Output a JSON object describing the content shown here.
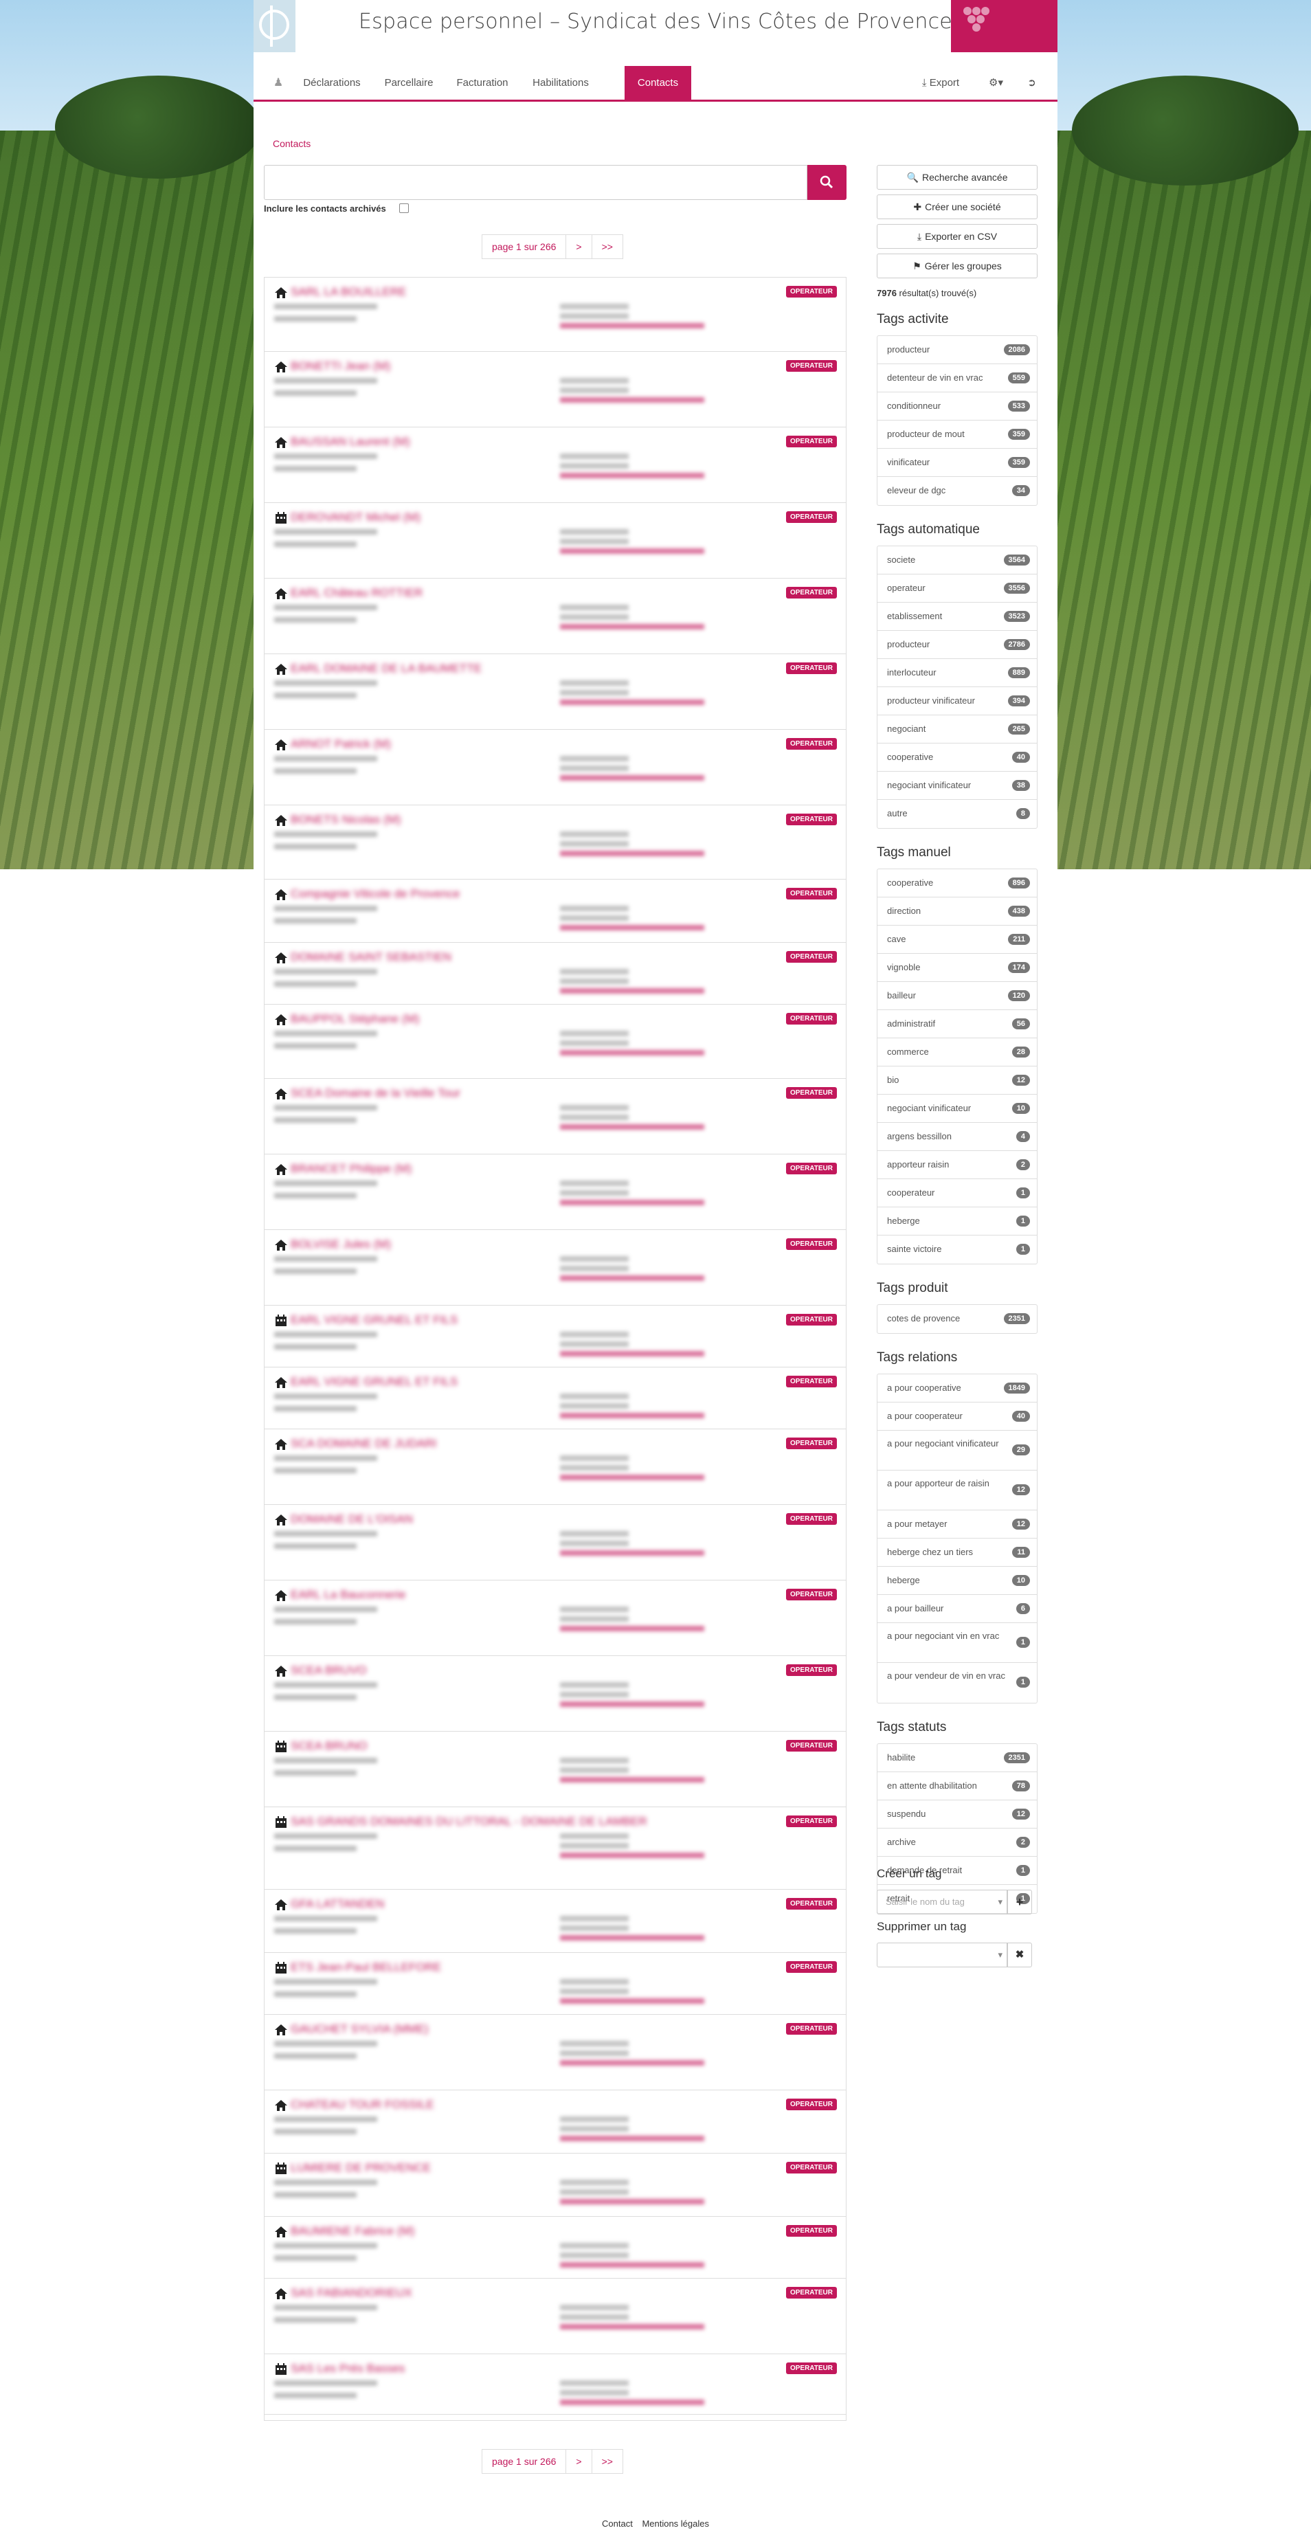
{
  "header": {
    "title": "Espace personnel – Syndicat des Vins Côtes de Provence"
  },
  "nav": {
    "items": [
      "Déclarations",
      "Parcellaire",
      "Facturation",
      "Habilitations",
      "Contacts"
    ],
    "export_label": "Export"
  },
  "breadcrumb": "Contacts",
  "search": {
    "placeholder": "",
    "archive_label": "Inclure les contacts archivés"
  },
  "pagination": {
    "label": "page 1 sur 266",
    "next": ">",
    "last": ">>"
  },
  "contacts": {
    "badge": "OPERATEUR",
    "rows": [
      {
        "icon": "home",
        "name": "SARL LA BOUILLERE"
      },
      {
        "icon": "home",
        "name": "BONETTI Jean (M)"
      },
      {
        "icon": "home",
        "name": "BAUSSAN Laurent (M)"
      },
      {
        "icon": "calendar",
        "name": "DEROVANDT Michel (M)"
      },
      {
        "icon": "home",
        "name": "EARL Château ROTTIER"
      },
      {
        "icon": "home",
        "name": "EARL DOMAINE DE LA BAUMETTE"
      },
      {
        "icon": "home",
        "name": "ARNOT Patrick (M)"
      },
      {
        "icon": "home",
        "name": "BONETS Nicolas (M)"
      },
      {
        "icon": "home",
        "name": "Compagnie Viticole de Provence"
      },
      {
        "icon": "home",
        "name": "DOMAINE SAINT SEBASTIEN"
      },
      {
        "icon": "home",
        "name": "BAUPPOL Stéphane (M)"
      },
      {
        "icon": "home",
        "name": "SCEA Domaine de la Vieille Tour"
      },
      {
        "icon": "home",
        "name": "BRANCET Philippe (M)"
      },
      {
        "icon": "home",
        "name": "BOLVISE Jules (M)"
      },
      {
        "icon": "calendar",
        "name": "EARL VIGNE GRUNEL ET FILS"
      },
      {
        "icon": "home",
        "name": "EARL VIGNE GRUNEL ET FILS"
      },
      {
        "icon": "home",
        "name": "SCA DOMAINE DE JUDARI"
      },
      {
        "icon": "home",
        "name": "DOMAINE DE L'OISAN"
      },
      {
        "icon": "home",
        "name": "EARL La Bauconnerie"
      },
      {
        "icon": "home",
        "name": "SCEA BRUVO"
      },
      {
        "icon": "calendar",
        "name": "SCEA BRUNO"
      },
      {
        "icon": "calendar",
        "name": "SAS GRANDS DOMAINES DU LITTORAL - DOMAINE DE LAMBER"
      },
      {
        "icon": "home",
        "name": "GFA LATTANDEN"
      },
      {
        "icon": "calendar",
        "name": "ETS Jean-Paul BELLEFORE"
      },
      {
        "icon": "home",
        "name": "GAUCHET SYLVIA (MME)"
      },
      {
        "icon": "home",
        "name": "CHATEAU TOUR FOSSILE"
      },
      {
        "icon": "calendar",
        "name": "LUMIERE DE PROVENCE"
      },
      {
        "icon": "home",
        "name": "BAUMIENE Fabrice (M)"
      },
      {
        "icon": "home",
        "name": "SAS FABIANDORIEUX"
      },
      {
        "icon": "calendar",
        "name": "SAS Les Prés Basses"
      }
    ]
  },
  "sidebar": {
    "buttons": [
      "Recherche avancée",
      "Créer une société",
      "Exporter en CSV",
      "Gérer les groupes"
    ],
    "result_count": "7976",
    "result_label": " résultat(s) trouvé(s)",
    "groups": [
      {
        "title": "Tags activite",
        "items": [
          {
            "label": "producteur",
            "count": "2086"
          },
          {
            "label": "detenteur de vin en vrac",
            "count": "559"
          },
          {
            "label": "conditionneur",
            "count": "533"
          },
          {
            "label": "producteur de mout",
            "count": "359"
          },
          {
            "label": "vinificateur",
            "count": "359"
          },
          {
            "label": "eleveur de dgc",
            "count": "34"
          }
        ]
      },
      {
        "title": "Tags automatique",
        "items": [
          {
            "label": "societe",
            "count": "3564"
          },
          {
            "label": "operateur",
            "count": "3556"
          },
          {
            "label": "etablissement",
            "count": "3523"
          },
          {
            "label": "producteur",
            "count": "2786"
          },
          {
            "label": "interlocuteur",
            "count": "889"
          },
          {
            "label": "producteur vinificateur",
            "count": "394"
          },
          {
            "label": "negociant",
            "count": "265"
          },
          {
            "label": "cooperative",
            "count": "40"
          },
          {
            "label": "negociant vinificateur",
            "count": "38"
          },
          {
            "label": "autre",
            "count": "8"
          }
        ]
      },
      {
        "title": "Tags manuel",
        "items": [
          {
            "label": "cooperative",
            "count": "896"
          },
          {
            "label": "direction",
            "count": "438"
          },
          {
            "label": "cave",
            "count": "211"
          },
          {
            "label": "vignoble",
            "count": "174"
          },
          {
            "label": "bailleur",
            "count": "120"
          },
          {
            "label": "administratif",
            "count": "56"
          },
          {
            "label": "commerce",
            "count": "28"
          },
          {
            "label": "bio",
            "count": "12"
          },
          {
            "label": "negociant vinificateur",
            "count": "10"
          },
          {
            "label": "argens bessillon",
            "count": "4"
          },
          {
            "label": "apporteur raisin",
            "count": "2"
          },
          {
            "label": "cooperateur",
            "count": "1"
          },
          {
            "label": "heberge",
            "count": "1"
          },
          {
            "label": "sainte victoire",
            "count": "1"
          }
        ]
      },
      {
        "title": "Tags produit",
        "items": [
          {
            "label": "cotes de provence",
            "count": "2351"
          }
        ]
      },
      {
        "title": "Tags relations",
        "items": [
          {
            "label": "a pour cooperative",
            "count": "1849"
          },
          {
            "label": "a pour cooperateur",
            "count": "40"
          },
          {
            "label": "a pour negociant vinificateur",
            "count": "29"
          },
          {
            "label": "a pour apporteur de raisin",
            "count": "12"
          },
          {
            "label": "a pour metayer",
            "count": "12"
          },
          {
            "label": "heberge chez un tiers",
            "count": "11"
          },
          {
            "label": "heberge",
            "count": "10"
          },
          {
            "label": "a pour bailleur",
            "count": "6"
          },
          {
            "label": "a pour negociant vin en vrac",
            "count": "1"
          },
          {
            "label": "a pour vendeur de vin en vrac",
            "count": "1"
          }
        ]
      },
      {
        "title": "Tags statuts",
        "items": [
          {
            "label": "habilite",
            "count": "2351"
          },
          {
            "label": "en attente dhabilitation",
            "count": "78"
          },
          {
            "label": "suspendu",
            "count": "12"
          },
          {
            "label": "archive",
            "count": "2"
          },
          {
            "label": "demande de retrait",
            "count": "1"
          },
          {
            "label": "retrait",
            "count": "1"
          }
        ]
      }
    ],
    "create_tag": {
      "title": "Créer un tag",
      "placeholder": "Saisir le nom du tag"
    },
    "delete_tag": {
      "title": "Supprimer un tag"
    }
  },
  "footer": {
    "contact": "Contact",
    "legal": "Mentions légales"
  },
  "colors": {
    "accent": "#c2185b"
  }
}
